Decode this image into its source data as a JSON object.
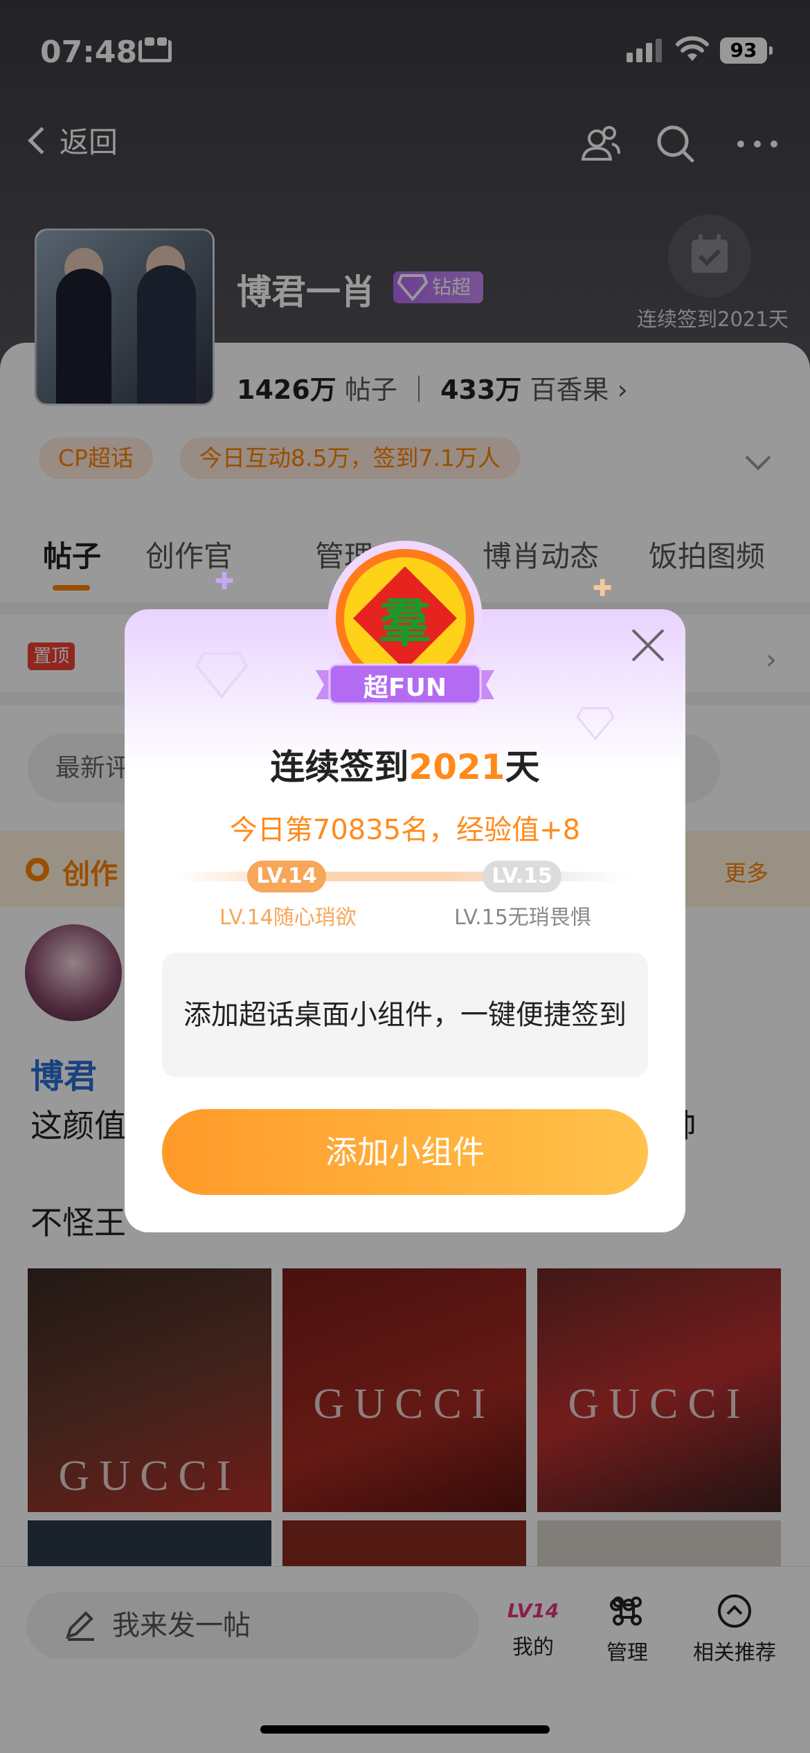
{
  "status_bar": {
    "time": "07:48",
    "battery": "93"
  },
  "nav": {
    "back_label": "返回"
  },
  "topic": {
    "title": "博君一肖",
    "badge": "钻超",
    "checkin_streak_text": "连续签到2021天",
    "posts_count": "1426万",
    "posts_label": "帖子",
    "fruit_count": "433万",
    "fruit_label": "百香果",
    "tag_cp": "CP超话",
    "tag_today": "今日互动8.5万，签到7.1万人"
  },
  "tabs": [
    "帖子",
    "创作官",
    "管理",
    "博肖动态",
    "饭拍图频"
  ],
  "pinned_label": "置顶",
  "search_placeholder": "最新评",
  "creator": {
    "label": "创作",
    "more": "更多"
  },
  "post": {
    "author": "博君",
    "text_line1": "这颜值",
    "text_right": "帅",
    "text_line2": "不怪王",
    "photo_brand": "GUCCI"
  },
  "bottom": {
    "compose_placeholder": "我来发一帖",
    "items": [
      {
        "label": "我的",
        "badge": "LV14"
      },
      {
        "label": "管理"
      },
      {
        "label": "相关推荐"
      }
    ]
  },
  "modal": {
    "medal_char": "羣",
    "ribbon": "超FUN",
    "title_prefix": "连续签到",
    "title_days": "2021",
    "title_suffix": "天",
    "subtitle": "今日第70835名，经验值+8",
    "level_current": "LV.14",
    "level_next": "LV.15",
    "level_current_caption": "LV.14随心琑欲",
    "level_next_caption": "LV.15无琑畏惧",
    "widget_text": "添加超话桌面小组件，一键便捷签到",
    "button_label": "添加小组件",
    "accent_color": "#ff8a1a"
  }
}
